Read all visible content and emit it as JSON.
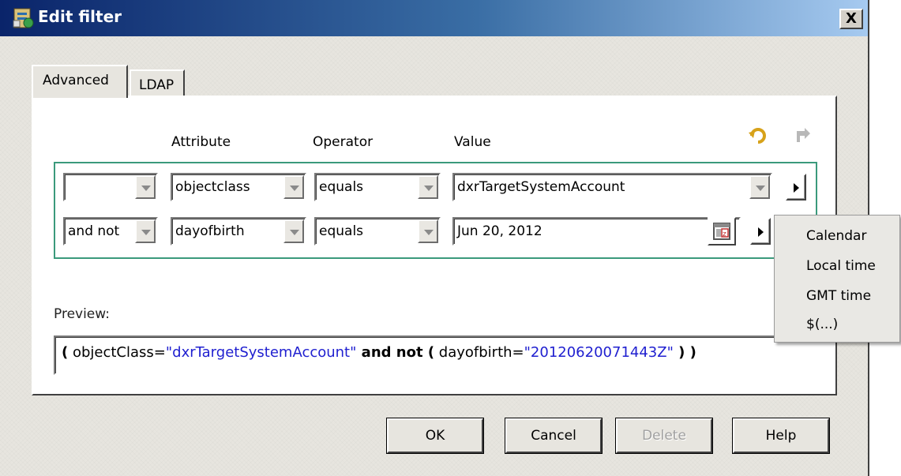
{
  "window": {
    "title": "Edit filter",
    "close_label": "X"
  },
  "tabs": [
    {
      "label": "Advanced",
      "active": true
    },
    {
      "label": "LDAP",
      "active": false
    }
  ],
  "columns": {
    "attribute": "Attribute",
    "operator": "Operator",
    "value": "Value"
  },
  "rows": [
    {
      "connector": "",
      "attribute": "objectclass",
      "operator": "equals",
      "value": "dxrTargetSystemAccount"
    },
    {
      "connector": "and not",
      "attribute": "dayofbirth",
      "operator": "equals",
      "value": "Jun 20, 2012"
    }
  ],
  "preview": {
    "label": "Preview:",
    "open1": "(",
    "attr1": " objectClass=",
    "val1": "\"dxrTargetSystemAccount\"",
    "op": " and not (",
    "attr2": " dayofbirth=",
    "val2": "\"20120620071443Z\"",
    "close": " ) )"
  },
  "context_menu": {
    "items": [
      "Calendar",
      "Local time",
      "GMT time",
      "$(...)"
    ]
  },
  "buttons": {
    "ok": "OK",
    "cancel": "Cancel",
    "delete": "Delete",
    "help": "Help"
  },
  "colors": {
    "title_start": "#0a246a",
    "title_end": "#a6caf0",
    "group_border": "#3b9a7c",
    "preview_value": "#2020d0"
  }
}
